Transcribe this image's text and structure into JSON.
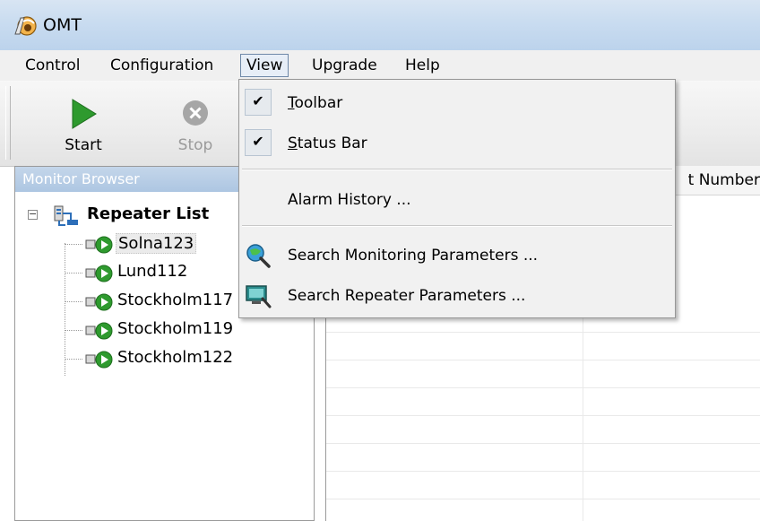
{
  "window": {
    "title": "OMT"
  },
  "menubar": {
    "items": [
      {
        "label": "Control"
      },
      {
        "label": "Configuration"
      },
      {
        "label": "View"
      },
      {
        "label": "Upgrade"
      },
      {
        "label": "Help"
      }
    ]
  },
  "toolbar": {
    "start_label": "Start",
    "stop_label": "Stop"
  },
  "monitor_browser": {
    "title": "Monitor Browser",
    "root_label": "Repeater List",
    "repeaters": [
      "Solna123",
      "Lund112",
      "Stockholm117",
      "Stockholm119",
      "Stockholm122"
    ],
    "selected": "Solna123"
  },
  "table": {
    "visible_header": "t Number"
  },
  "view_menu": {
    "toolbar": {
      "accel": "T",
      "rest": "oolbar",
      "checked": true
    },
    "status_bar": {
      "accel": "S",
      "rest": "tatus Bar",
      "checked": true
    },
    "alarm_history": "Alarm History ...",
    "search_monitoring": "Search Monitoring Parameters ...",
    "search_repeater": "Search Repeater Parameters ..."
  },
  "colors": {
    "start_green": "#2e9a2e",
    "titlebar": "#c9dcf0",
    "pane_header": "#b6cde6"
  }
}
